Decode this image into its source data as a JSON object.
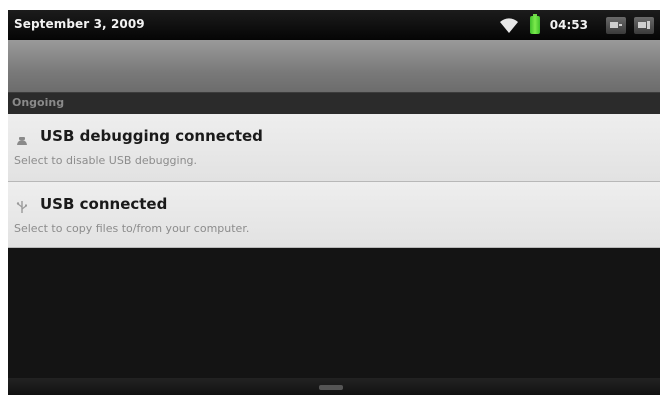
{
  "status_bar": {
    "date": "September 3, 2009",
    "time": "04:53",
    "icons": [
      "wifi-icon",
      "battery-icon",
      "notification-icon",
      "notification-icon"
    ],
    "battery_color": "#3fbf2c"
  },
  "notifications": {
    "section_title": "Ongoing",
    "items": [
      {
        "icon": "usb-debug-icon",
        "title": "USB debugging connected",
        "subtitle": "Select to disable USB debugging."
      },
      {
        "icon": "usb-icon",
        "title": "USB connected",
        "subtitle": "Select to copy files to/from your computer."
      }
    ]
  },
  "colors": {
    "item_background": "#e8e8e8",
    "section_background": "#2b2b2b",
    "header_band": "#8a8a8a"
  }
}
